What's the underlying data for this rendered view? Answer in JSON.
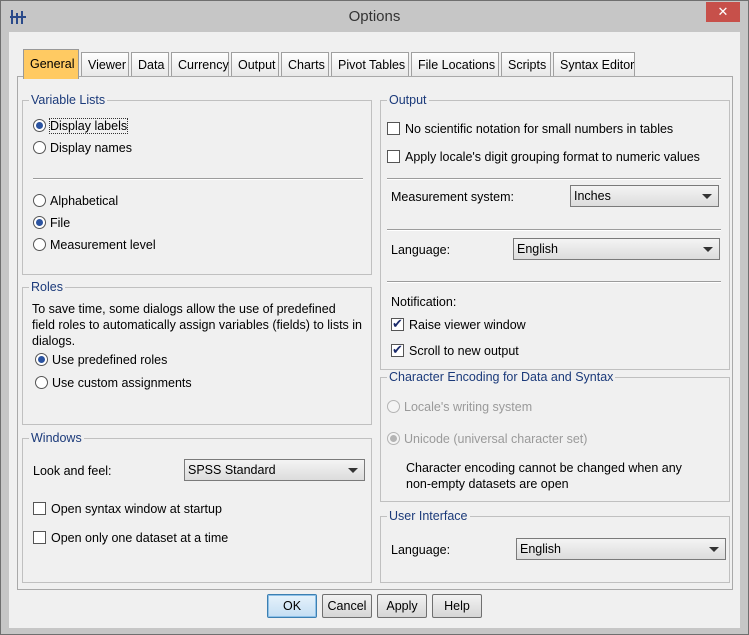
{
  "window": {
    "title": "Options",
    "close_glyph": "✕",
    "app_icon": "spss-app-icon"
  },
  "tabs": [
    {
      "label": "General",
      "active": true
    },
    {
      "label": "Viewer"
    },
    {
      "label": "Data"
    },
    {
      "label": "Currency"
    },
    {
      "label": "Output"
    },
    {
      "label": "Charts"
    },
    {
      "label": "Pivot Tables"
    },
    {
      "label": "File Locations"
    },
    {
      "label": "Scripts"
    },
    {
      "label": "Syntax Editor"
    }
  ],
  "variable_lists": {
    "legend": "Variable Lists",
    "display_labels": "Display labels",
    "display_names": "Display names",
    "alphabetical": "Alphabetical",
    "file": "File",
    "measurement_level": "Measurement level"
  },
  "roles": {
    "legend": "Roles",
    "description": "To save time, some dialogs allow the use of predefined field roles to automatically assign variables (fields) to lists in dialogs.",
    "use_predefined": "Use predefined roles",
    "use_custom": "Use custom assignments"
  },
  "windows": {
    "legend": "Windows",
    "look_and_feel_label": "Look and feel:",
    "look_and_feel_value": "SPSS Standard",
    "open_syntax": "Open syntax window at startup",
    "one_dataset": "Open only one dataset at a time"
  },
  "output": {
    "legend": "Output",
    "no_scientific": "No scientific notation for small numbers in tables",
    "apply_locale": "Apply locale's digit  grouping format to numeric values",
    "measurement_label": "Measurement system:",
    "measurement_value": "Inches",
    "language_label": "Language:",
    "language_value": "English",
    "notification_label": "Notification:",
    "raise_viewer": "Raise viewer window",
    "scroll_output": "Scroll to new output"
  },
  "encoding": {
    "legend": "Character Encoding for Data and Syntax",
    "locale_writing": "Locale's writing system",
    "unicode": "Unicode (universal character set)",
    "note": "Character encoding cannot be changed when any non-empty datasets are open"
  },
  "ui": {
    "legend": "User Interface",
    "language_label": "Language:",
    "language_value": "English"
  },
  "buttons": {
    "ok": "OK",
    "cancel": "Cancel",
    "apply": "Apply",
    "help": "Help"
  }
}
